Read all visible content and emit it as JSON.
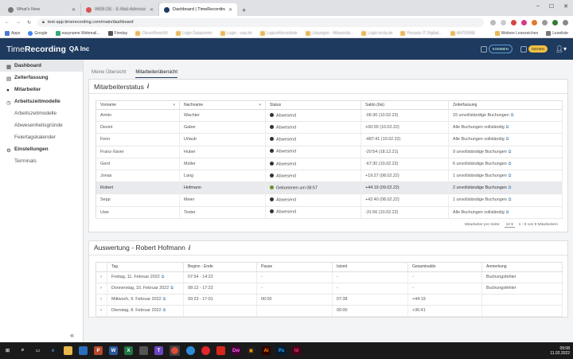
{
  "browser": {
    "tabs": [
      {
        "label": "What's New",
        "color": "#888888"
      },
      {
        "label": "WEB.DE - E-Mail-Adresse kostenlos",
        "color": "#d9534f"
      },
      {
        "label": "Dashboard | TimeRecording",
        "color": "#1e3a5f"
      }
    ],
    "url": "test-app.timerecording.com/main/dashboard",
    "bookmarks": [
      "Apps",
      "Google",
      "easyname Webmail...",
      "Fireday",
      "CleverReach®",
      "Login Datacenter",
      "Login - eap.de",
      "LogicoRecordsde",
      "Lösungen - Wissensb...",
      "Login.tecta.de",
      "Panasis IT Digitali...",
      "ANTENNE"
    ],
    "bookmarks_right": [
      "Weitere Lesezeichen",
      "Leseliste"
    ]
  },
  "app": {
    "logo_prefix": "Time",
    "logo_main": "Recording",
    "company": "QA Inc",
    "btn_kommen": "KOMMEN",
    "btn_gehen": "GEHEN"
  },
  "sidebar": {
    "items": [
      {
        "label": "Dashboard",
        "kind": "top",
        "active": true
      },
      {
        "label": "Zeiterfassung",
        "kind": "top"
      },
      {
        "label": "Mitarbeiter",
        "kind": "top"
      },
      {
        "label": "Arbeitszeitmodelle",
        "kind": "top"
      },
      {
        "label": "Arbeitszeitmodelle",
        "kind": "sub"
      },
      {
        "label": "Abwesenheitsgründe",
        "kind": "sub"
      },
      {
        "label": "Feiertagskalender",
        "kind": "sub"
      },
      {
        "label": "Einstellungen",
        "kind": "top"
      },
      {
        "label": "Terminals",
        "kind": "sub"
      }
    ],
    "collapse": "«"
  },
  "main": {
    "tabs": [
      "Meine Übersicht",
      "Mitarbeiterübersicht"
    ],
    "active_tab": 1
  },
  "status_card": {
    "title": "Mitarbeiterstatus",
    "info": "i",
    "columns": [
      "Vorname",
      "Nachname",
      "Status",
      "Saldo (bis)",
      "Zeiterfassung"
    ],
    "rows": [
      {
        "vorname": "Armin",
        "nachname": "Wachter",
        "status": "Abwesend",
        "saldo": "-06:30 (10.02.22)",
        "zeit": "15 unvollständige Buchungen"
      },
      {
        "vorname": "Desiré",
        "nachname": "Gaber",
        "status": "Abwesend",
        "saldo": "+00:00 (10.02.22)",
        "zeit": "Alle Buchungen vollständig"
      },
      {
        "vorname": "Fenn",
        "nachname": "Urlaub",
        "status": "Abwesend",
        "saldo": "-487:41 (10.02.22)",
        "zeit": "Alle Buchungen vollständig"
      },
      {
        "vorname": "Franz-Xaver",
        "nachname": "Huber",
        "status": "Abwesend",
        "saldo": "-20:54 (18.12.21)",
        "zeit": "9 unvollständige Buchungen"
      },
      {
        "vorname": "Gerd",
        "nachname": "Müller",
        "status": "Abwesend",
        "saldo": "-67:30 (10.02.22)",
        "zeit": "6 unvollständige Buchungen"
      },
      {
        "vorname": "Jonas",
        "nachname": "Lang",
        "status": "Abwesend",
        "saldo": "+19:27 (08.02.22)",
        "zeit": "1 unvollständige Buchungen"
      },
      {
        "vorname": "Robert",
        "nachname": "Hofmann",
        "status": "Gekommen um 08:57",
        "saldo": "+44:19 (09.02.22)",
        "zeit": "2 unvollständige Buchungen",
        "highlight": true
      },
      {
        "vorname": "Sepp",
        "nachname": "Meier",
        "status": "Abwesend",
        "saldo": "+42:40 (08.02.22)",
        "zeit": "1 unvollständige Buchungen"
      },
      {
        "vorname": "Uwe",
        "nachname": "Tester",
        "status": "Abwesend",
        "saldo": "-31:56 (10.02.22)",
        "zeit": "Alle Buchungen vollständig"
      }
    ],
    "pager_label": "Mitarbeiter pro Seite:",
    "pager_value": "10",
    "pager_range": "1 - 9 von 9 Mitarbeitern"
  },
  "eval_card": {
    "title": "Auswertung - Robert Hofmann",
    "info": "i",
    "columns": [
      "Tag",
      "Beginn - Ende",
      "Pause",
      "Istzeit",
      "Gesamtsaldo",
      "Anmerkung"
    ],
    "rows": [
      {
        "tag": "Freitag, 11. Februar 2022",
        "zeit": "07:54 - 14:22",
        "pause": "-",
        "ist": "-",
        "saldo": "-",
        "anm": "Buchungsfehler"
      },
      {
        "tag": "Donnerstag, 10. Februar 2022",
        "zeit": "08:12 - 17:22",
        "pause": "-",
        "ist": "-",
        "saldo": "-",
        "anm": "Buchungsfehler"
      },
      {
        "tag": "Mittwoch, 9. Februar 2022",
        "zeit": "09:23 - 17:01",
        "pause": "00:00",
        "ist": "07:38",
        "saldo": "+44:19",
        "anm": ""
      },
      {
        "tag": "Dienstag, 8. Februar 2022",
        "zeit": "",
        "pause": "",
        "ist": "00:00",
        "saldo": "+36:41",
        "anm": ""
      }
    ]
  },
  "taskbar": {
    "time": "09:08",
    "date": "11.02.2022"
  },
  "colors": {
    "header": "#1e3a5f",
    "gehen": "#f0c040",
    "present": "#6a8f2a"
  }
}
